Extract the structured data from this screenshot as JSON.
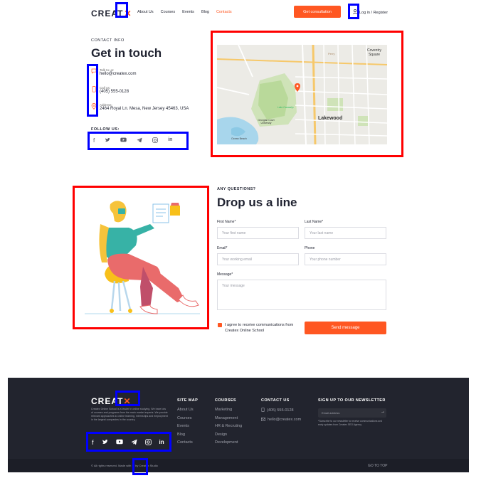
{
  "header": {
    "logo_text": "CREAT",
    "logo_mark": "✕",
    "nav": [
      "About Us",
      "Courses",
      "Events",
      "Blog",
      "Contacts"
    ],
    "active_nav": "Contacts",
    "cta_label": "Get consultation",
    "login_label": "Log in / Register"
  },
  "contact": {
    "eyebrow": "CONTACT INFO",
    "title": "Get in touch",
    "items": [
      {
        "icon": "chat-icon",
        "label": "Talk to us:",
        "value": "hello@createx.com"
      },
      {
        "icon": "phone-icon",
        "label": "Call us:",
        "value": "(405) 555-0128"
      },
      {
        "icon": "map-pin-icon",
        "label": "Address:",
        "value": "2464 Royal Ln. Mesa, New Jersey 45463, USA"
      }
    ],
    "follow_label": "FOLLOW US:",
    "socials": [
      "f",
      "🐦",
      "▶",
      "✈",
      "◎",
      "in"
    ]
  },
  "map": {
    "labels": [
      "Coventry Square",
      "Lakewood",
      "Ocean Beach",
      "Georgian Court University",
      "Lake Carasaljo",
      "Perry"
    ]
  },
  "form": {
    "eyebrow": "ANY QUESTIONS?",
    "title": "Drop us a line",
    "first_name_label": "First Name*",
    "first_name_placeholder": "Your first name",
    "last_name_label": "Last Name*",
    "last_name_placeholder": "Your last name",
    "email_label": "Email*",
    "email_placeholder": "Your working email",
    "phone_label": "Phone",
    "phone_placeholder": "Your phone number",
    "message_label": "Message*",
    "message_placeholder": "Your message",
    "agree_text": "I agree to receive communications from Createx Online School",
    "send_label": "Send message"
  },
  "footer": {
    "logo_text": "CREAT",
    "logo_mark": "✕",
    "description": "Createx Online School is a leader in online studying. We have lots of courses and programs from the main market experts. We provide relevant approaches to online learning, internships and employment in the largest companies in the country.",
    "sitemap_title": "SITE MAP",
    "sitemap": [
      "About Us",
      "Courses",
      "Events",
      "Blog",
      "Contacts"
    ],
    "courses_title": "COURSES",
    "courses": [
      "Marketing",
      "Management",
      "HR & Recruting",
      "Design",
      "Development"
    ],
    "contact_title": "CONTACT US",
    "contact_phone": "(405) 555-0128",
    "contact_email": "hello@createx.com",
    "newsletter_title": "SIGN UP TO OUR NEWSLETTER",
    "newsletter_placeholder": "Email address",
    "newsletter_note": "*Subscribe to our newsletter to receive communications and early updates from Createx SEO Agency.",
    "socials": [
      "f",
      "🐦",
      "▶",
      "✈",
      "◎",
      "in"
    ],
    "copyright": "© All rights reserved. Made with ♡ by Createx Studio",
    "go_top": "GO TO TOP"
  },
  "colors": {
    "accent": "#ff5722",
    "dark": "#22242e",
    "highlight_blue": "#0000ff",
    "highlight_red": "#ff0000"
  }
}
